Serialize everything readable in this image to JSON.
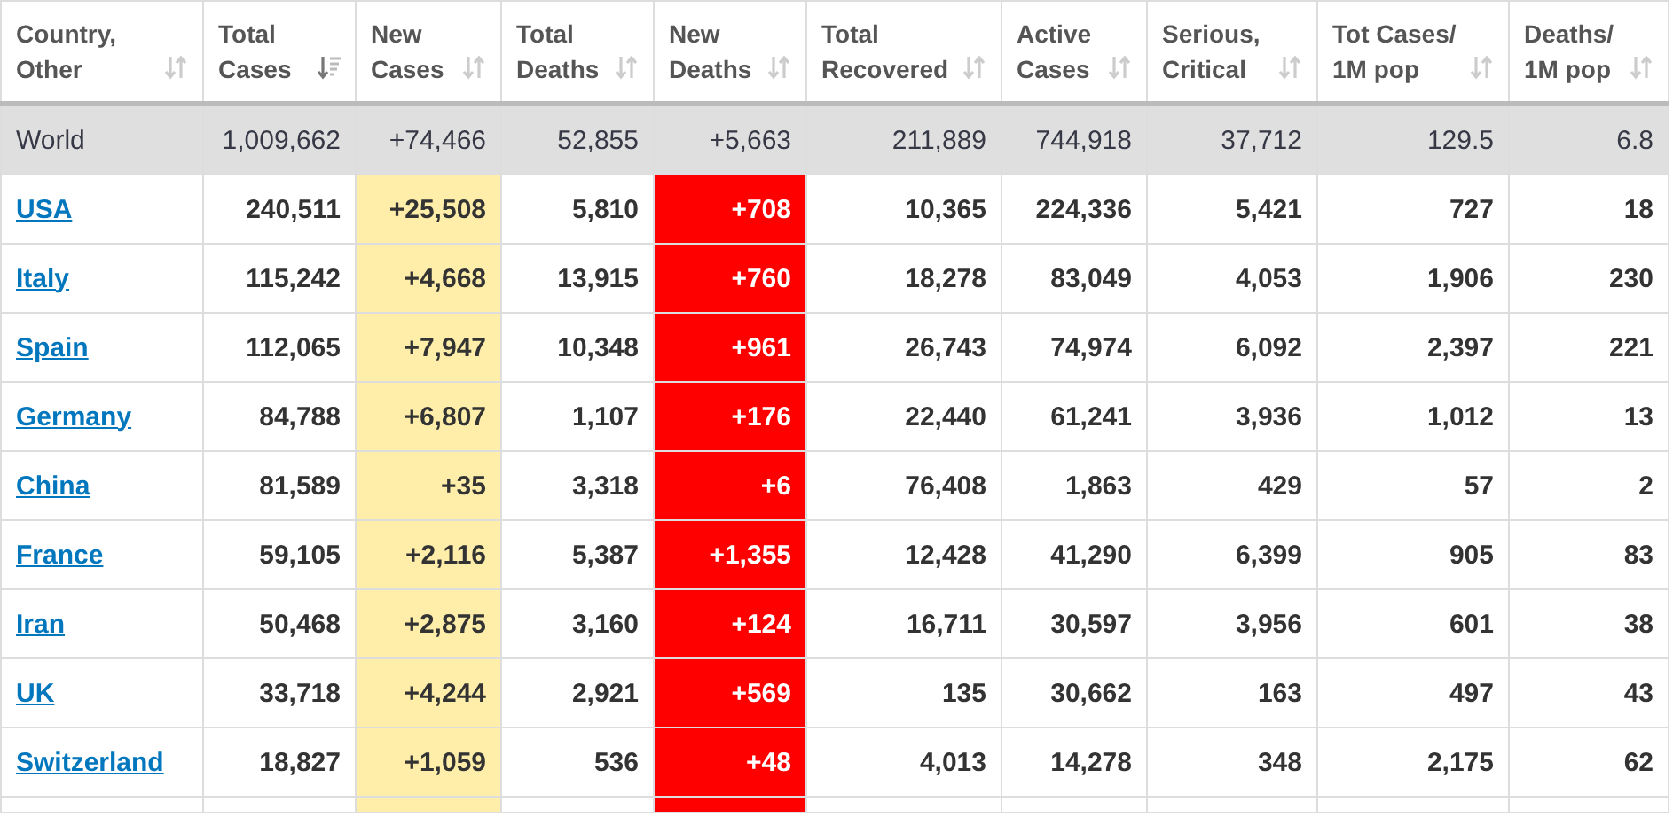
{
  "table": {
    "columns": [
      {
        "label": "Country, Other",
        "kind": "country",
        "sorted": false
      },
      {
        "label": "Total Cases",
        "kind": "plain",
        "sorted": true
      },
      {
        "label": "New Cases",
        "kind": "new_cases",
        "sorted": false
      },
      {
        "label": "Total Deaths",
        "kind": "plain",
        "sorted": false
      },
      {
        "label": "New Deaths",
        "kind": "new_deaths",
        "sorted": false
      },
      {
        "label": "Total Recovered",
        "kind": "plain",
        "sorted": false
      },
      {
        "label": "Active Cases",
        "kind": "plain",
        "sorted": false
      },
      {
        "label": "Serious, Critical",
        "kind": "plain",
        "sorted": false
      },
      {
        "label": "Tot Cases/ 1M pop",
        "kind": "plain",
        "sorted": false
      },
      {
        "label": "Deaths/ 1M pop",
        "kind": "plain",
        "sorted": false
      }
    ],
    "rows": [
      {
        "kind": "total",
        "cells": [
          "World",
          "1,009,662",
          "+74,466",
          "52,855",
          "+5,663",
          "211,889",
          "744,918",
          "37,712",
          "129.5",
          "6.8"
        ]
      },
      {
        "kind": "country",
        "cells": [
          "USA",
          "240,511",
          "+25,508",
          "5,810",
          "+708",
          "10,365",
          "224,336",
          "5,421",
          "727",
          "18"
        ]
      },
      {
        "kind": "country",
        "cells": [
          "Italy",
          "115,242",
          "+4,668",
          "13,915",
          "+760",
          "18,278",
          "83,049",
          "4,053",
          "1,906",
          "230"
        ]
      },
      {
        "kind": "country",
        "cells": [
          "Spain",
          "112,065",
          "+7,947",
          "10,348",
          "+961",
          "26,743",
          "74,974",
          "6,092",
          "2,397",
          "221"
        ]
      },
      {
        "kind": "country",
        "cells": [
          "Germany",
          "84,788",
          "+6,807",
          "1,107",
          "+176",
          "22,440",
          "61,241",
          "3,936",
          "1,012",
          "13"
        ]
      },
      {
        "kind": "country",
        "cells": [
          "China",
          "81,589",
          "+35",
          "3,318",
          "+6",
          "76,408",
          "1,863",
          "429",
          "57",
          "2"
        ]
      },
      {
        "kind": "country",
        "cells": [
          "France",
          "59,105",
          "+2,116",
          "5,387",
          "+1,355",
          "12,428",
          "41,290",
          "6,399",
          "905",
          "83"
        ]
      },
      {
        "kind": "country",
        "cells": [
          "Iran",
          "50,468",
          "+2,875",
          "3,160",
          "+124",
          "16,711",
          "30,597",
          "3,956",
          "601",
          "38"
        ]
      },
      {
        "kind": "country",
        "cells": [
          "UK",
          "33,718",
          "+4,244",
          "2,921",
          "+569",
          "135",
          "30,662",
          "163",
          "497",
          "43"
        ]
      },
      {
        "kind": "country",
        "cells": [
          "Switzerland",
          "18,827",
          "+1,059",
          "536",
          "+48",
          "4,013",
          "14,278",
          "348",
          "2,175",
          "62"
        ]
      }
    ]
  }
}
